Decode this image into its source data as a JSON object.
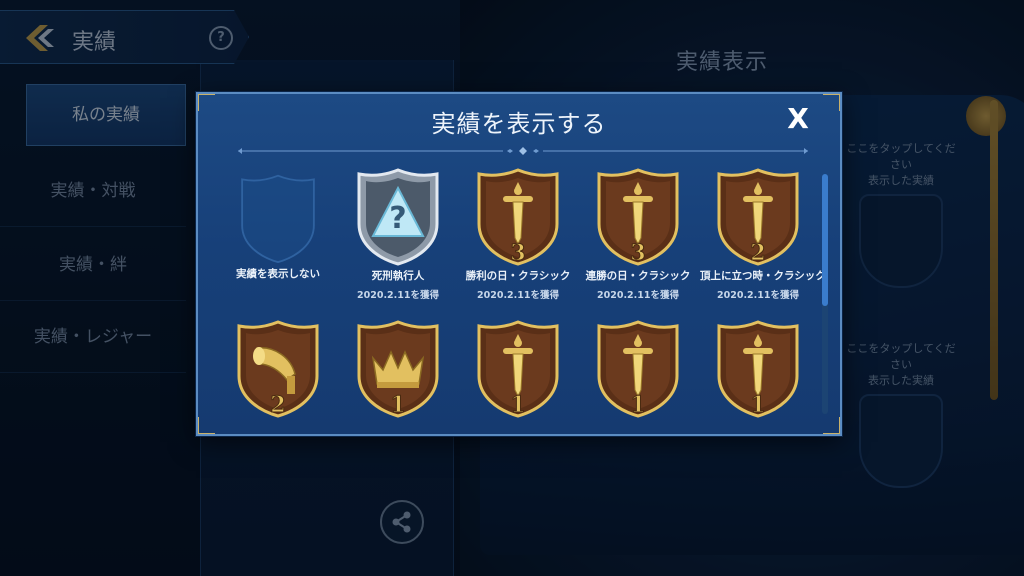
{
  "header": {
    "title": "実績",
    "help_icon": "question-circle-icon",
    "back_icon": "back-chevron-icon"
  },
  "sidebar": {
    "items": [
      {
        "label": "私の実績",
        "active": true
      },
      {
        "label": "実績・対戦",
        "active": false
      },
      {
        "label": "実績・絆",
        "active": false
      },
      {
        "label": "実績・レジャー",
        "active": false
      }
    ]
  },
  "background": {
    "title": "実績表示",
    "slots": [
      {
        "hint": "ここをタップしてください",
        "label": "表示した実績"
      },
      {
        "hint": "ここをタップしてください",
        "label": "表示した実績"
      }
    ]
  },
  "modal": {
    "title": "実績を表示する",
    "close_label": "X",
    "badges": [
      {
        "name": "実績を表示しない",
        "date": "",
        "style": "empty",
        "icon": "empty-shield-icon"
      },
      {
        "name": "死刑執行人",
        "date": "2020.2.11を獲得",
        "style": "silver",
        "icon": "mystery-shield-icon"
      },
      {
        "name": "勝利の日・クラシック",
        "date": "2020.2.11を獲得",
        "style": "bronze",
        "icon": "sword-badge-icon",
        "level": "3"
      },
      {
        "name": "連勝の日・クラシック",
        "date": "2020.2.11を獲得",
        "style": "bronze",
        "icon": "sword-badge-icon",
        "level": "3"
      },
      {
        "name": "頂上に立つ時・クラシック",
        "date": "2020.2.11を獲得",
        "style": "bronze",
        "icon": "sword-badge-icon",
        "level": "2"
      },
      {
        "name": "",
        "date": "",
        "style": "bronze",
        "icon": "gramophone-badge-icon",
        "level": "2"
      },
      {
        "name": "",
        "date": "",
        "style": "bronze",
        "icon": "crown-badge-icon",
        "level": "1"
      },
      {
        "name": "",
        "date": "",
        "style": "bronze",
        "icon": "sword-badge-icon",
        "level": "1"
      },
      {
        "name": "",
        "date": "",
        "style": "bronze",
        "icon": "sword-badge-icon",
        "level": "1"
      },
      {
        "name": "",
        "date": "",
        "style": "bronze",
        "icon": "sword-badge-icon",
        "level": "1"
      }
    ]
  },
  "colors": {
    "modal_bg": "#174079",
    "modal_border": "#5b8cc2",
    "gold": "#e2c060",
    "bronze": "#6b3a1e"
  }
}
